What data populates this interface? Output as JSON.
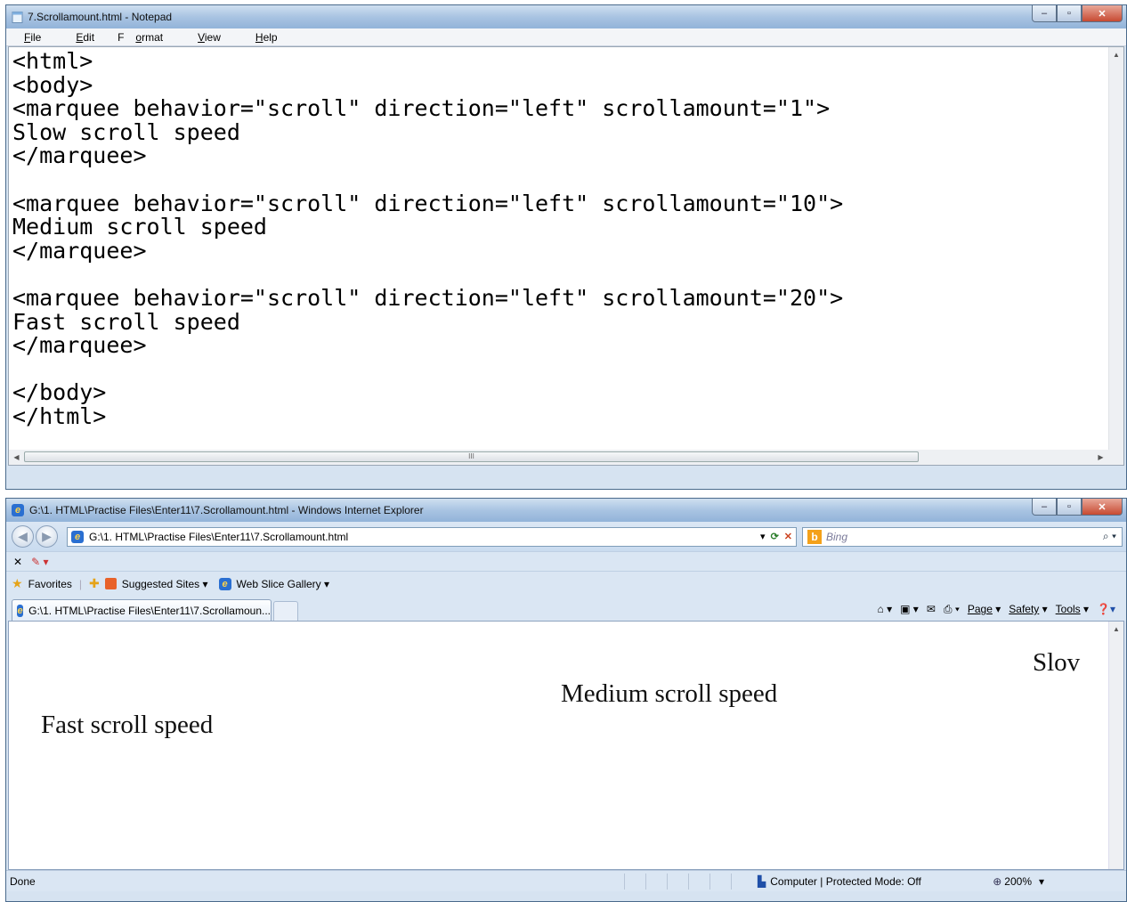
{
  "notepad": {
    "title": "7.Scrollamount.html - Notepad",
    "menu": [
      {
        "pre": "",
        "key": "F",
        "post": "ile"
      },
      {
        "pre": "",
        "key": "E",
        "post": "dit"
      },
      {
        "pre": "F",
        "key": "o",
        "post": "rmat"
      },
      {
        "pre": "",
        "key": "V",
        "post": "iew"
      },
      {
        "pre": "",
        "key": "H",
        "post": "elp"
      }
    ],
    "code_lines": [
      "<html>",
      "<body>",
      "<marquee behavior=\"scroll\" direction=\"left\" scrollamount=\"1\">",
      "Slow scroll speed",
      "</marquee>",
      "",
      "<marquee behavior=\"scroll\" direction=\"left\" scrollamount=\"10\">",
      "Medium scroll speed",
      "</marquee>",
      "",
      "<marquee behavior=\"scroll\" direction=\"left\" scrollamount=\"20\">",
      "Fast scroll speed",
      "</marquee>",
      "",
      "</body>",
      "</html>"
    ],
    "hscroll_grip": "III"
  },
  "ie": {
    "title": "G:\\1. HTML\\Practise Files\\Enter11\\7.Scrollamount.html - Windows Internet Explorer",
    "address": "G:\\1. HTML\\Practise Files\\Enter11\\7.Scrollamount.html",
    "search_placeholder": "Bing",
    "favorites_label": "Favorites",
    "suggested_sites_label": "Suggested Sites ▾",
    "web_slice_label": "Web Slice Gallery ▾",
    "tab_title": "G:\\1. HTML\\Practise Files\\Enter11\\7.Scrollamoun...",
    "commands": {
      "page": "Page",
      "safety": "Safety",
      "tools": "Tools"
    },
    "marquees": {
      "slow": "Slov",
      "medium": "Medium scroll speed",
      "fast": "Fast scroll speed"
    },
    "status": {
      "left": "Done",
      "zone": "Computer | Protected Mode: Off",
      "zoom": "200%"
    }
  },
  "icons": [
    "notepad-icon",
    "minimize-icon",
    "maximize-icon",
    "close-icon",
    "back-icon",
    "forward-icon",
    "ie-page-icon",
    "refresh-icon",
    "stop-icon",
    "bing-icon",
    "search-icon",
    "favorites-star-icon",
    "home-icon",
    "feeds-icon",
    "mail-icon",
    "print-icon",
    "help-icon",
    "zoom-icon"
  ],
  "colors": {
    "title_gradient_top": "#cfdff0",
    "title_gradient_bottom": "#92b3d9",
    "close_button": "#c74a32",
    "chrome_bg": "#dae6f3"
  }
}
